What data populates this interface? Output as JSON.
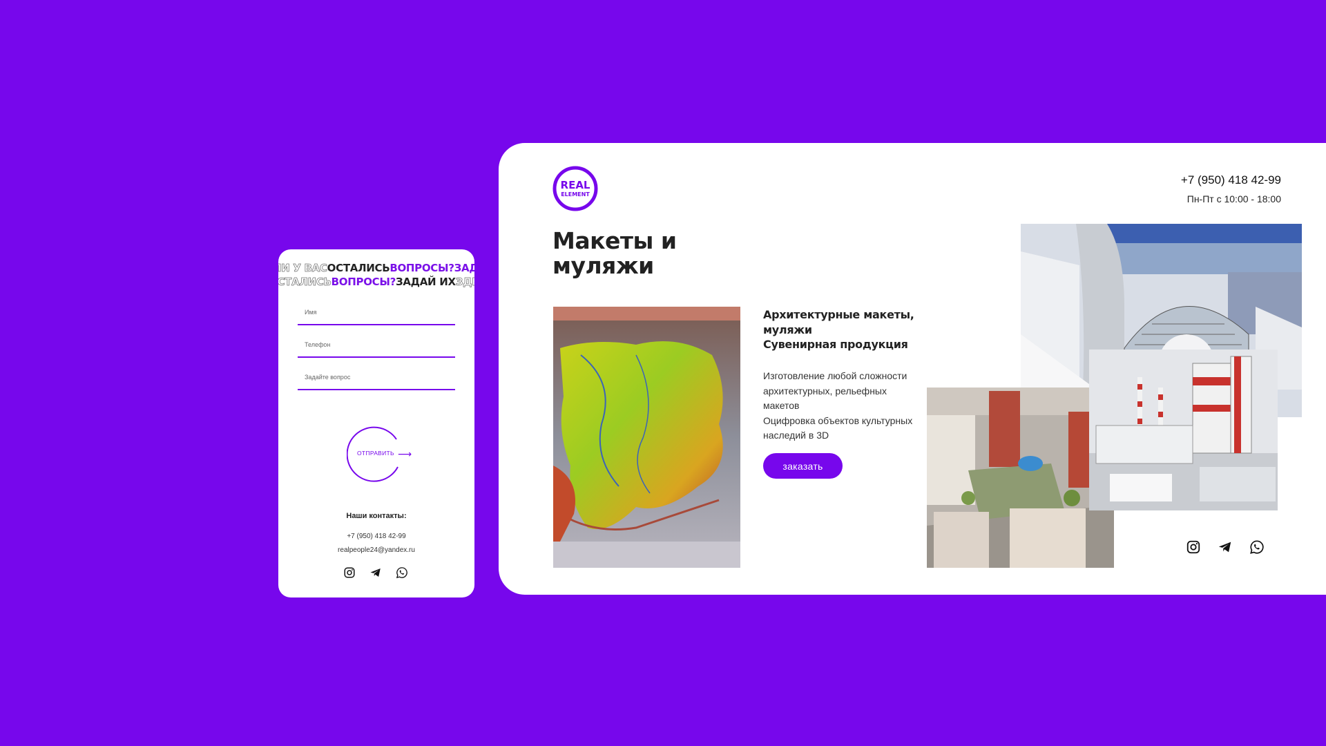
{
  "colors": {
    "background": "#7707ec",
    "accent": "#7707ec",
    "card": "#ffffff"
  },
  "mobile": {
    "marquee_line1": {
      "a": "ЛИ У ВАС ",
      "b": "ОСТАЛИСЬ ",
      "c": "ВОПРОСЫ? ",
      "d": "ЗАДА"
    },
    "marquee_line2": {
      "a": "ОСТАЛИСЬ ",
      "b": "ВОПРОСЫ? ",
      "c": "ЗАДАЙ ИХ ",
      "d": "ЗДЕ"
    },
    "form": {
      "name_placeholder": "Имя",
      "phone_placeholder": "Телефон",
      "question_placeholder": "Задайте вопрос"
    },
    "send_label": "ОТПРАВИТЬ",
    "contacts_title": "Наши контакты:",
    "phone": "+7 (950) 418 42-99",
    "email": "realpeople24@yandex.ru",
    "social_icons": [
      "instagram-icon",
      "telegram-icon",
      "whatsapp-icon"
    ]
  },
  "desktop": {
    "logo": {
      "line1": "REAL",
      "line2": "ELEMENT"
    },
    "phone": "+7 (950) 418 42-99",
    "hours": "Пн-Пт с 10:00 - 18:00",
    "title_line1": "Макеты и",
    "title_line2": "муляжи",
    "subtitle_lines": [
      "Архитектурные макеты,",
      "муляжи",
      "Сувенирная продукция"
    ],
    "description_lines": [
      "Изготовление любой сложности",
      "архитектурных, рельефных",
      "макетов",
      "Оцифровка объектов культурных",
      "наследий в 3D"
    ],
    "order_button": "заказать",
    "social_icons": [
      "instagram-icon",
      "telegram-icon",
      "whatsapp-icon"
    ]
  }
}
